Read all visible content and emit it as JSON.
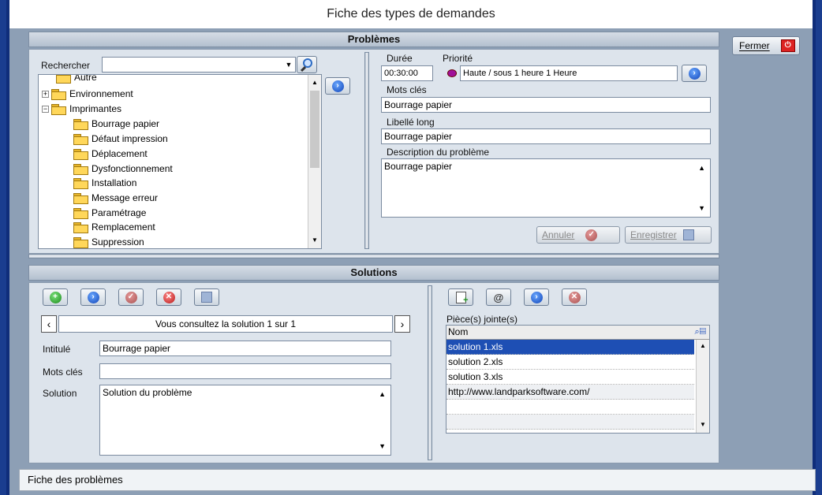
{
  "window": {
    "title": "Fiche des types de demandes"
  },
  "close_button": {
    "label": "Fermer"
  },
  "problems": {
    "header": "Problèmes",
    "search_label": "Rechercher",
    "search_value": "",
    "tree": [
      {
        "label": "Autre",
        "level": 0
      },
      {
        "label": "Environnement",
        "level": 0,
        "expander": "+"
      },
      {
        "label": "Imprimantes",
        "level": 0,
        "expander": "−"
      },
      {
        "label": "Bourrage papier",
        "level": 1
      },
      {
        "label": "Défaut impression",
        "level": 1
      },
      {
        "label": "Déplacement",
        "level": 1
      },
      {
        "label": "Dysfonctionnement",
        "level": 1
      },
      {
        "label": "Installation",
        "level": 1
      },
      {
        "label": "Message erreur",
        "level": 1
      },
      {
        "label": "Paramétrage",
        "level": 1
      },
      {
        "label": "Remplacement",
        "level": 1
      },
      {
        "label": "Suppression",
        "level": 1
      }
    ],
    "duree_label": "Durée",
    "duree_value": "00:30:00",
    "priorite_label": "Priorité",
    "priorite_value": "Haute / sous 1 heure   1 Heure",
    "priorite_color": "#a0109a",
    "mots_cles_label": "Mots clés",
    "mots_cles_value": "Bourrage papier",
    "libelle_label": "Libellé long",
    "libelle_value": "Bourrage papier",
    "description_label": "Description du problème",
    "description_value": "Bourrage papier",
    "annuler_label": "Annuler",
    "enregistrer_label": "Enregistrer"
  },
  "solutions": {
    "header": "Solutions",
    "nav_text": "Vous consultez la solution 1 sur 1",
    "intitule_label": "Intitulé",
    "intitule_value": "Bourrage papier",
    "mots_cles_label": "Mots clés",
    "mots_cles_value": "",
    "solution_label": "Solution",
    "solution_value": "Solution du problème",
    "attachments_label": "Pièce(s) jointe(s)",
    "attachments_column": "Nom",
    "attachments": [
      "solution 1.xls",
      "solution 2.xls",
      "solution 3.xls",
      "http://www.landparksoftware.com/",
      "",
      ""
    ]
  },
  "status_bar": {
    "text": "Fiche des problèmes"
  },
  "colors": {
    "accent_blue": "#1043b8",
    "selection": "#1e4fb4"
  }
}
